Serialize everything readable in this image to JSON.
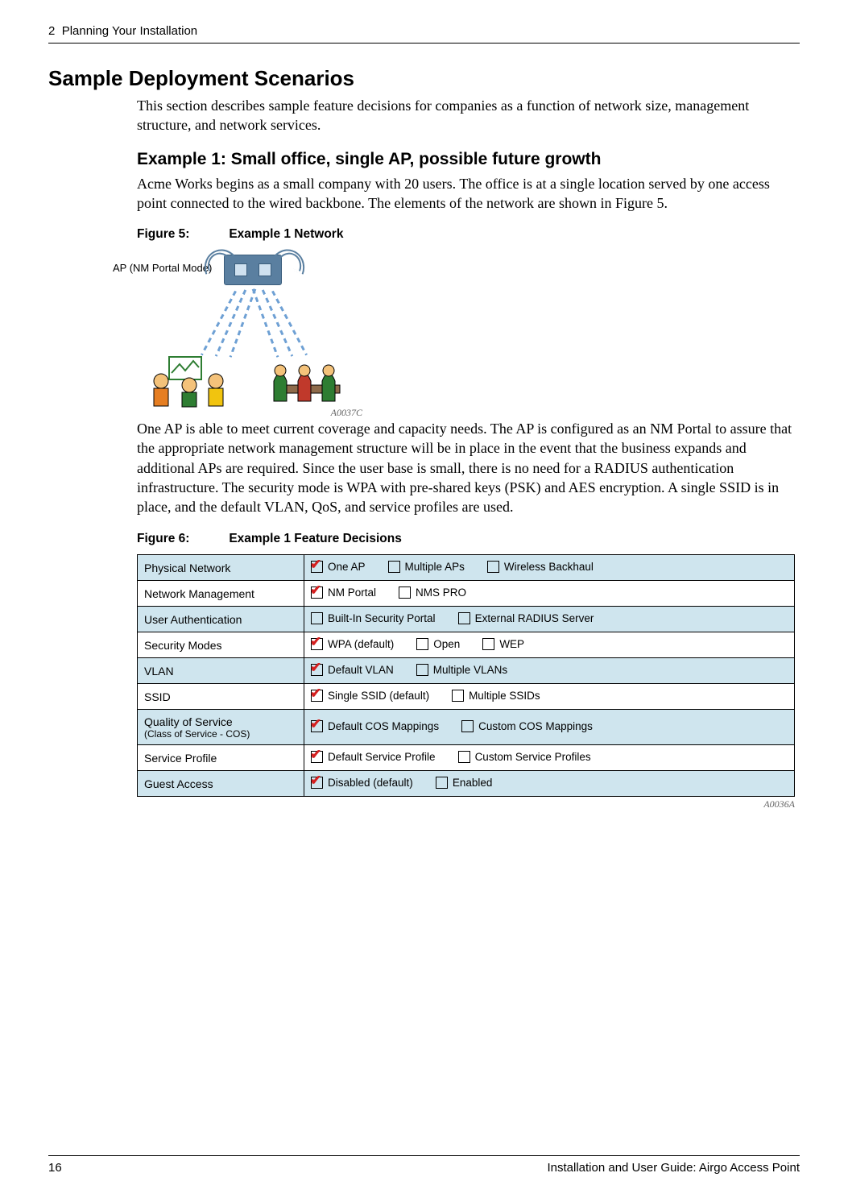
{
  "header": {
    "chapter": "2",
    "chapter_title": "Planning Your Installation"
  },
  "section_heading": "Sample Deployment Scenarios",
  "intro_para": "This section describes sample feature decisions for companies as a function of network size, management structure, and network services.",
  "example1": {
    "heading": "Example 1: Small office, single AP, possible future growth",
    "para1": "Acme Works begins as a small company with 20 users. The office is at a single location served by one access point connected to the wired backbone. The elements of the network are shown in Figure 5.",
    "fig5_num": "Figure 5:",
    "fig5_title": "Example 1 Network",
    "fig5_ap_label": "AP (NM Portal Mode)",
    "fig5_code": "A0037C",
    "para2": "One AP is able to meet current coverage and capacity needs. The AP is configured as an NM Portal to assure that the appropriate network management structure will be in place in the event that the business expands and additional APs are required. Since the user base is small, there is no need for a RADIUS authentication infrastructure. The security mode is WPA with pre-shared keys (PSK) and AES encryption. A single SSID is in place, and the default VLAN, QoS, and service profiles are used.",
    "fig6_num": "Figure 6:",
    "fig6_title": "Example 1 Feature Decisions",
    "fig6_code": "A0036A"
  },
  "feature_rows": [
    {
      "label": "Physical Network",
      "sub": "",
      "shade": true,
      "opts": [
        {
          "label": "One AP",
          "checked": true
        },
        {
          "label": "Multiple APs",
          "checked": false
        },
        {
          "label": "Wireless Backhaul",
          "checked": false
        }
      ]
    },
    {
      "label": "Network Management",
      "sub": "",
      "shade": false,
      "opts": [
        {
          "label": "NM Portal",
          "checked": true
        },
        {
          "label": "NMS PRO",
          "checked": false
        }
      ]
    },
    {
      "label": "User Authentication",
      "sub": "",
      "shade": true,
      "opts": [
        {
          "label": "Built-In Security Portal",
          "checked": false
        },
        {
          "label": "External RADIUS Server",
          "checked": false
        }
      ]
    },
    {
      "label": "Security Modes",
      "sub": "",
      "shade": false,
      "opts": [
        {
          "label": "WPA (default)",
          "checked": true
        },
        {
          "label": "Open",
          "checked": false
        },
        {
          "label": "WEP",
          "checked": false
        }
      ]
    },
    {
      "label": "VLAN",
      "sub": "",
      "shade": true,
      "opts": [
        {
          "label": "Default VLAN",
          "checked": true
        },
        {
          "label": "Multiple VLANs",
          "checked": false
        }
      ]
    },
    {
      "label": "SSID",
      "sub": "",
      "shade": false,
      "opts": [
        {
          "label": "Single SSID (default)",
          "checked": true
        },
        {
          "label": "Multiple SSIDs",
          "checked": false
        }
      ]
    },
    {
      "label": "Quality of Service",
      "sub": "(Class of Service - COS)",
      "shade": true,
      "opts": [
        {
          "label": "Default COS Mappings",
          "checked": true
        },
        {
          "label": "Custom COS Mappings",
          "checked": false
        }
      ]
    },
    {
      "label": "Service Profile",
      "sub": "",
      "shade": false,
      "opts": [
        {
          "label": "Default Service Profile",
          "checked": true
        },
        {
          "label": "Custom Service Profiles",
          "checked": false
        }
      ]
    },
    {
      "label": "Guest Access",
      "sub": "",
      "shade": true,
      "opts": [
        {
          "label": "Disabled (default)",
          "checked": true
        },
        {
          "label": "Enabled",
          "checked": false
        }
      ]
    }
  ],
  "footer": {
    "page_num": "16",
    "doc_title": "Installation and User Guide: Airgo Access Point"
  }
}
